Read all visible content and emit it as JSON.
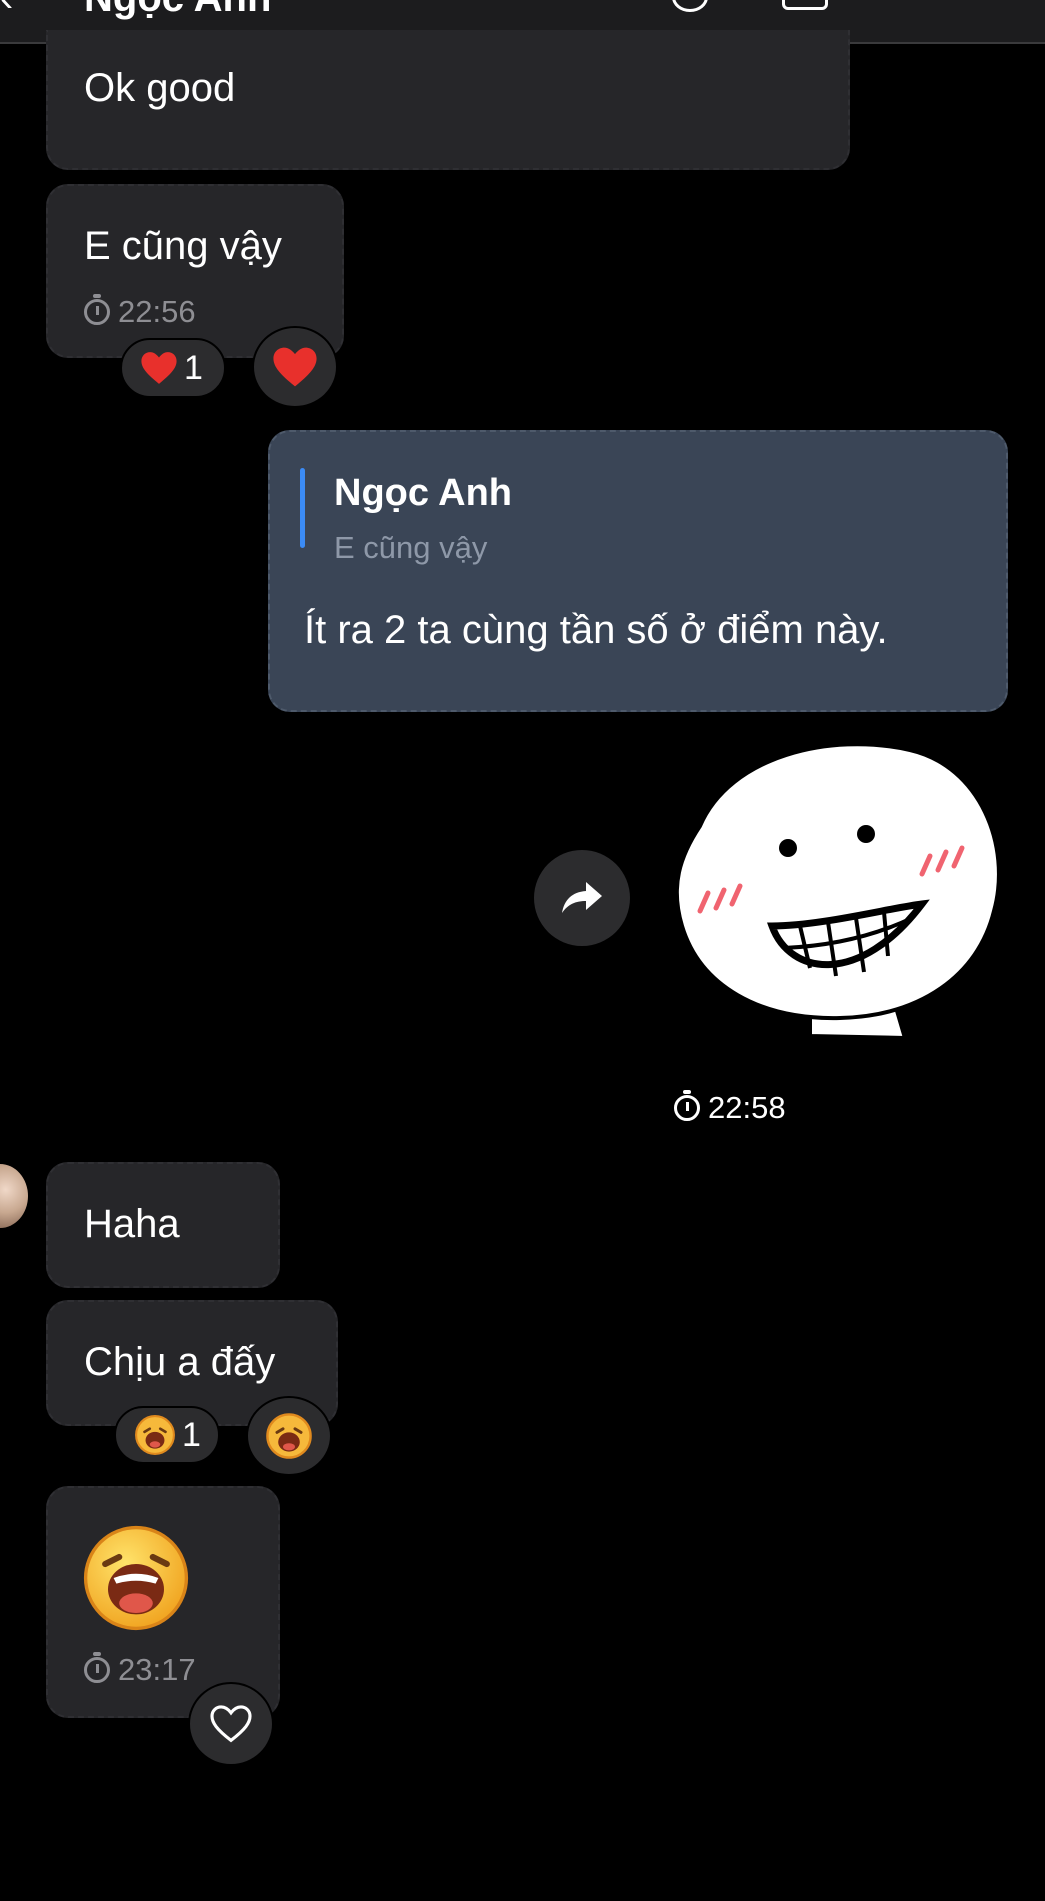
{
  "header": {
    "back_glyph": "‹",
    "contact_name": "Ngọc Anh",
    "icons": [
      "back-icon",
      "call-icon",
      "video-icon",
      "more-icon"
    ]
  },
  "messages": {
    "m1": {
      "text": "Ok good"
    },
    "m2": {
      "text": "E cũng vậy",
      "time": "22:56",
      "reaction_count": "1",
      "reaction_icon": "heart-icon",
      "quick_reaction_icon": "heart-icon"
    },
    "m3": {
      "reply_to_name": "Ngọc Anh",
      "reply_to_text": "E cũng vậy",
      "text": "Ít ra 2 ta cùng tần số ở điểm này."
    },
    "m4": {
      "sticker": "grinning-blob-sticker",
      "time": "22:58",
      "forward_icon": "forward-icon"
    },
    "m5": {
      "text": "Haha"
    },
    "m6": {
      "text": "Chịu a đấy",
      "reaction_count": "1",
      "reaction_icon": "laughing-emoji-icon",
      "quick_reaction_icon": "laughing-emoji-icon"
    },
    "m7": {
      "emoji": "laughing-emoji-icon",
      "time": "23:17",
      "reaction_button_icon": "heart-outline-icon"
    }
  },
  "colors": {
    "background": "#000000",
    "incoming_bubble": "#262629",
    "outgoing_bubble": "#3a4556",
    "reply_accent": "#3b8bf5",
    "muted_text": "#8e8e93",
    "heart_red": "#e8302c"
  }
}
